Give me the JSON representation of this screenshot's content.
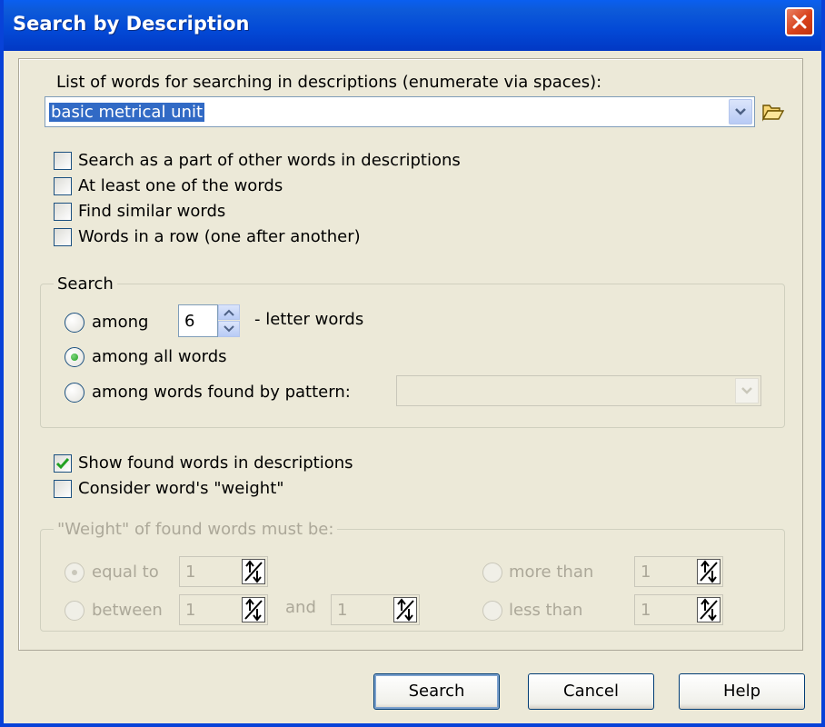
{
  "window": {
    "title": "Search by Description"
  },
  "words": {
    "label": "List of words for searching in descriptions (enumerate via spaces):",
    "value": "basic metrical unit"
  },
  "options": [
    {
      "label": "Search as a part of other words in descriptions",
      "checked": false
    },
    {
      "label": "At least one of the words",
      "checked": false
    },
    {
      "label": "Find similar words",
      "checked": false
    },
    {
      "label": "Words in a row (one after another)",
      "checked": false
    }
  ],
  "search_group": {
    "legend": "Search",
    "among_label": "among",
    "letter_count": "6",
    "letter_suffix": "- letter words",
    "all_words_label": "among all words",
    "pattern_label": "among words found by pattern:",
    "selected": "among all words"
  },
  "show_found": {
    "label": "Show found words in descriptions",
    "checked": true
  },
  "consider_weight": {
    "label": "Consider word's \"weight\"",
    "checked": false
  },
  "weight_group": {
    "legend": "\"Weight\" of found words must be:",
    "equal_label": "equal to",
    "equal_value": "1",
    "between_label": "between",
    "between_from": "1",
    "and_label": "and",
    "between_to": "1",
    "more_label": "more than",
    "more_value": "1",
    "less_label": "less than",
    "less_value": "1"
  },
  "buttons": {
    "search": "Search",
    "cancel": "Cancel",
    "help": "Help"
  }
}
